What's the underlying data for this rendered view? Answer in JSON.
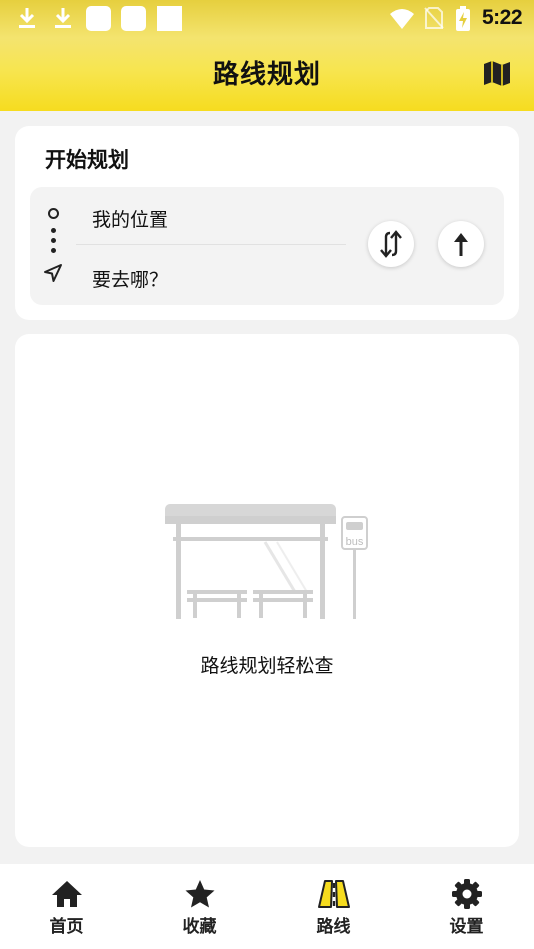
{
  "status_bar": {
    "time": "5:22",
    "icons": [
      "download-icon",
      "download-icon",
      "app-icon",
      "app-icon",
      "app-icon",
      "wifi-icon",
      "no-sim-icon",
      "battery-charging-icon"
    ]
  },
  "header": {
    "title": "路线规划",
    "map_icon": "map-icon"
  },
  "planner": {
    "title": "开始规划",
    "from": "我的位置",
    "to": "要去哪？",
    "swap_icon": "swap-icon",
    "go_icon": "arrow-up-icon"
  },
  "empty_state": {
    "illustration": "bus-stop-illustration",
    "message": "路线规划轻松查",
    "sign_text": "bus"
  },
  "bottom_nav": {
    "items": [
      {
        "label": "首页",
        "icon": "home-icon"
      },
      {
        "label": "收藏",
        "icon": "star-icon"
      },
      {
        "label": "路线",
        "icon": "route-icon",
        "active": true
      },
      {
        "label": "设置",
        "icon": "gear-icon"
      }
    ]
  },
  "colors": {
    "accent": "#f6dc1f",
    "active_icon": "#f6dc1f"
  }
}
